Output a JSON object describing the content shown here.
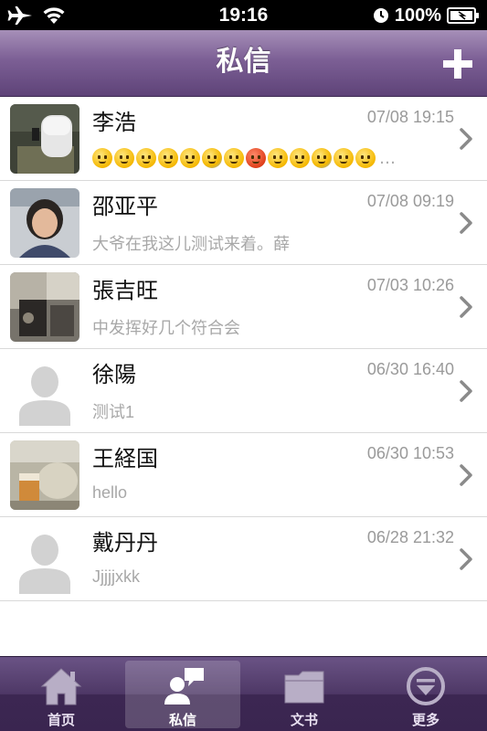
{
  "status_bar": {
    "time": "19:16",
    "battery": "100%",
    "icons": [
      "airplane-icon",
      "wifi-icon",
      "clock-icon",
      "battery-icon"
    ]
  },
  "nav": {
    "title": "私信",
    "add_icon": "plus-icon"
  },
  "messages": [
    {
      "name": "李浩",
      "time": "07/08 19:15",
      "preview": "",
      "preview_type": "emoji",
      "emoji_ellipsis": "…",
      "avatar": "photo-device"
    },
    {
      "name": "邵亚平",
      "time": "07/08 09:19",
      "preview": "大爷在我这儿测试来着。薛",
      "avatar": "photo-person"
    },
    {
      "name": "張吉旺",
      "time": "07/03 10:26",
      "preview": "中发挥好几个符合会",
      "avatar": "photo-room"
    },
    {
      "name": "徐陽",
      "time": "06/30 16:40",
      "preview": "测试1",
      "avatar": "default-silhouette"
    },
    {
      "name": "王経国",
      "time": "06/30 10:53",
      "preview": "hello",
      "avatar": "photo-drink"
    },
    {
      "name": "戴丹丹",
      "time": "06/28 21:32",
      "preview": "Jjjjjxkk",
      "avatar": "default-silhouette"
    }
  ],
  "tabs": [
    {
      "label": "首页",
      "icon": "home-icon",
      "active": false
    },
    {
      "label": "私信",
      "icon": "message-icon",
      "active": true
    },
    {
      "label": "文书",
      "icon": "folder-icon",
      "active": false
    },
    {
      "label": "更多",
      "icon": "more-icon",
      "active": false
    }
  ],
  "colors": {
    "nav_purple": "#7c5f95",
    "tab_purple": "#4e3866",
    "time_gray": "#9a9a9a",
    "preview_gray": "#a8a8a8"
  }
}
